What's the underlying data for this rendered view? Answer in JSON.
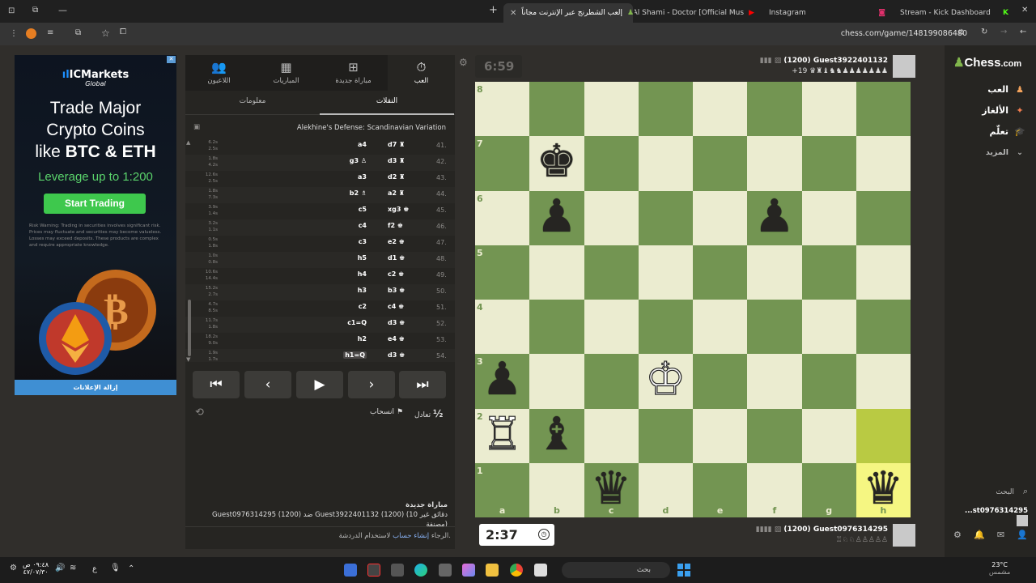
{
  "browser": {
    "tabs": [
      {
        "title": "إلعب الشطرنج عبر الإنترنت مجاناً",
        "active": true
      },
      {
        "title": "Al Shami - Doctor [Official Mus"
      },
      {
        "title": "Instagram"
      },
      {
        "title": "Stream - Kick Dashboard"
      }
    ],
    "url": "chess.com/game/148199086480"
  },
  "ad": {
    "logo": "ICMarkets",
    "logo_sub": "Global",
    "headline_1": "Trade Major",
    "headline_2": "Crypto Coins",
    "headline_3": "like",
    "headline_bold": "BTC & ETH",
    "leverage": "Leverage up to 1:200",
    "cta": "Start Trading",
    "risk": "Risk Warning: Trading in securities involves significant risk. Prices may fluctuate and securities may become valueless. Losses may exceed deposits. These products are complex and require appropriate knowledge.",
    "remove_ads": "إزالة الإعلانات"
  },
  "panel": {
    "tabs": [
      {
        "label": "اللاعبون",
        "icon": "players-icon"
      },
      {
        "label": "المباريات",
        "icon": "games-icon"
      },
      {
        "label": "مباراة جديدة",
        "icon": "new-game-icon"
      },
      {
        "label": "العب",
        "icon": "play-icon",
        "active": true
      }
    ],
    "subtabs": [
      {
        "label": "معلومات"
      },
      {
        "label": "النقلات",
        "active": true
      }
    ],
    "opening": "Alekhine's Defense: Scandinavian Variation",
    "moves": [
      {
        "n": "41.",
        "w": "d7 ♜",
        "b": "a4",
        "t1": "6.2s",
        "t2": "2.5s"
      },
      {
        "n": "42.",
        "w": "d3 ♜",
        "b": "g3 ♙",
        "t1": "1.8s",
        "t2": "4.2s"
      },
      {
        "n": "43.",
        "w": "d2 ♜",
        "b": "a3",
        "t1": "12.6s",
        "t2": "2.5s"
      },
      {
        "n": "44.",
        "w": "a2 ♜",
        "b": "b2 ♗",
        "t1": "1.8s",
        "t2": "7.3s"
      },
      {
        "n": "45.",
        "w": "xg3 ♚",
        "b": "c5",
        "t1": "3.9s",
        "t2": "1.4s"
      },
      {
        "n": "46.",
        "w": "f2 ♚",
        "b": "c4",
        "t1": "3.2s",
        "t2": "1.1s"
      },
      {
        "n": "47.",
        "w": "e2 ♚",
        "b": "c3",
        "t1": "0.5s",
        "t2": "1.8s"
      },
      {
        "n": "48.",
        "w": "d1 ♚",
        "b": "h5",
        "t1": "1.0s",
        "t2": "0.8s"
      },
      {
        "n": "49.",
        "w": "c2 ♚",
        "b": "h4",
        "t1": "10.6s",
        "t2": "14.4s"
      },
      {
        "n": "50.",
        "w": "b3 ♚",
        "b": "h3",
        "t1": "15.2s",
        "t2": "2.7s"
      },
      {
        "n": "51.",
        "w": "c4 ♚",
        "b": "c2",
        "t1": "4.7s",
        "t2": "8.5s"
      },
      {
        "n": "52.",
        "w": "d3 ♚",
        "b": "c1=Q",
        "t1": "11.7s",
        "t2": "1.8s"
      },
      {
        "n": "53.",
        "w": "e4 ♚",
        "b": "h2",
        "t1": "18.2s",
        "t2": "9.0s"
      },
      {
        "n": "54.",
        "w": "d3 ♚",
        "b": "h1=Q",
        "t1": "1.9s",
        "t2": "1.7s"
      }
    ],
    "draw": "تعادل",
    "draw_icon": "½",
    "resign": "انسحاب",
    "new_game_title": "مباراة جديدة",
    "new_game_desc": "Guest0976314295 (1200) ضد Guest3922401132 (1200) (10 دقائق غير مصنفة)",
    "chat_prefix": "الرجاء",
    "chat_link": "إنشاء حساب",
    "chat_suffix": "لاستخدام الدردشة."
  },
  "game": {
    "top_clock": "6:59",
    "bottom_clock": "2:37",
    "top_player": {
      "name": "Guest3922401132",
      "rating": "(1200)",
      "captured": "♛♜♝♞♞♟♟♟♟♟♟♟",
      "advantage": "+19"
    },
    "bottom_player": {
      "name": "Guest0976314295",
      "rating": "(1200)",
      "captured": "♖♘♘♙♙♙♙♙"
    },
    "ranks": [
      "8",
      "7",
      "6",
      "5",
      "4",
      "3",
      "2",
      "1"
    ],
    "files": [
      "a",
      "b",
      "c",
      "d",
      "e",
      "f",
      "g",
      "h"
    ],
    "pieces": [
      {
        "sq": "b7",
        "p": "♚",
        "color": "black"
      },
      {
        "sq": "b6",
        "p": "♟",
        "color": "black"
      },
      {
        "sq": "f6",
        "p": "♟",
        "color": "black"
      },
      {
        "sq": "a3",
        "p": "♟",
        "color": "black"
      },
      {
        "sq": "d3",
        "p": "♔",
        "color": "white"
      },
      {
        "sq": "a2",
        "p": "♖",
        "color": "white"
      },
      {
        "sq": "b2",
        "p": "♝",
        "color": "black"
      },
      {
        "sq": "c1",
        "p": "♛",
        "color": "black"
      },
      {
        "sq": "h1",
        "p": "♛",
        "color": "black"
      }
    ],
    "highlight": [
      "h2",
      "h1"
    ]
  },
  "sidebar": {
    "logo": "Chess",
    "logo_suffix": ".com",
    "items": [
      {
        "label": "العب",
        "icon": "play-icon"
      },
      {
        "label": "الألغاز",
        "icon": "puzzle-icon"
      },
      {
        "label": "تعلّم",
        "icon": "learn-icon"
      },
      {
        "label": "المزيد",
        "icon": "more-icon"
      }
    ],
    "search": "البحث",
    "friend": "...st0976314295"
  },
  "taskbar": {
    "search_placeholder": "بحث",
    "weather_temp": "23°C",
    "weather_desc": "مشمس",
    "time": "٠٩:٤٨ ص",
    "date": "٤٧/٠٧/٣٠",
    "lang": "ع"
  }
}
